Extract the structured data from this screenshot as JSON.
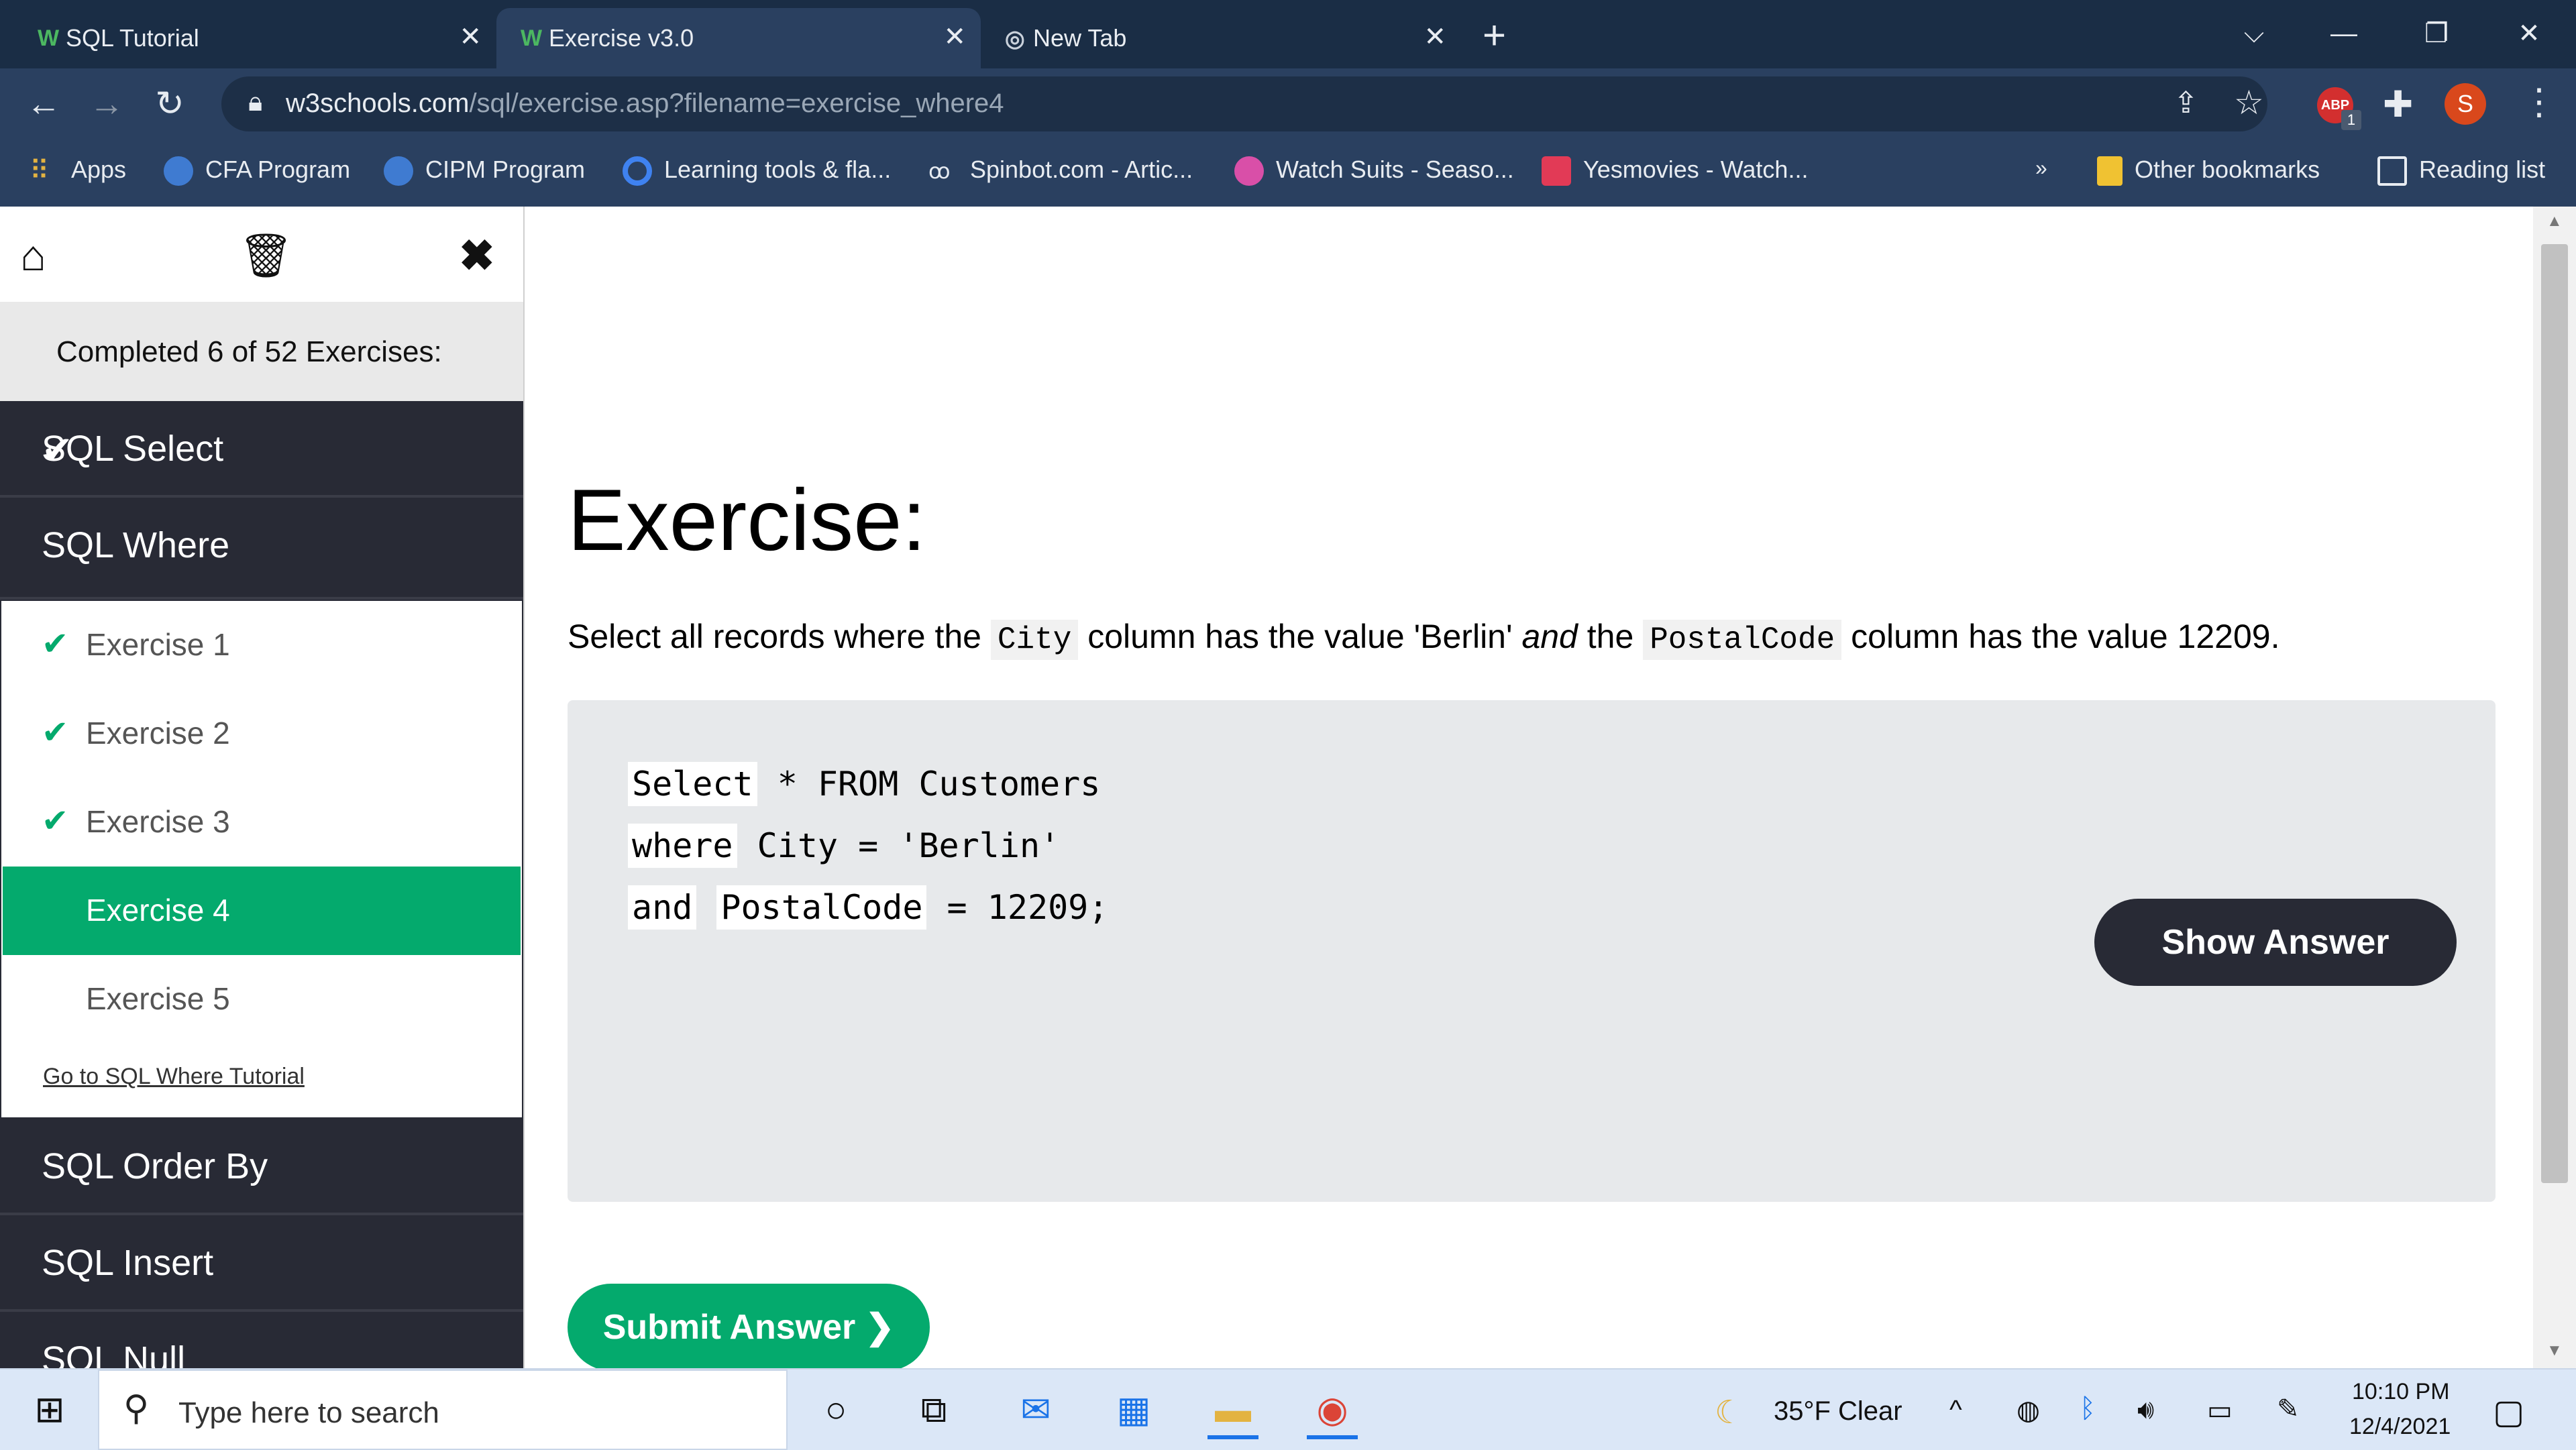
{
  "browser": {
    "tabs": [
      {
        "favicon": "W",
        "title": "SQL Tutorial"
      },
      {
        "favicon": "W",
        "title": "Exercise v3.0"
      },
      {
        "favicon": "chrome-icon",
        "title": "New Tab"
      }
    ],
    "url_host": "w3schools.com",
    "url_path": "/sql/exercise.asp?filename=exercise_where4",
    "profile_initial": "S",
    "bookmarks": [
      {
        "label": "Apps"
      },
      {
        "label": "CFA Program"
      },
      {
        "label": "CIPM Program"
      },
      {
        "label": "Learning tools & fla..."
      },
      {
        "label": "Spinbot.com - Artic..."
      },
      {
        "label": "Watch Suits - Seaso..."
      },
      {
        "label": "Yesmovies - Watch..."
      }
    ],
    "other_bookmarks": "Other bookmarks",
    "reading_list": "Reading list",
    "extension_badge": "1"
  },
  "sidebar": {
    "progress": "Completed 6 of 52 Exercises:",
    "sections_top": [
      {
        "label": "SQL Select",
        "completed": true
      },
      {
        "label": "SQL Where",
        "completed": false
      }
    ],
    "exercises": [
      {
        "label": "Exercise 1",
        "done": true
      },
      {
        "label": "Exercise 2",
        "done": true
      },
      {
        "label": "Exercise 3",
        "done": true
      },
      {
        "label": "Exercise 4",
        "active": true
      },
      {
        "label": "Exercise 5"
      }
    ],
    "tutorial_link": "Go to SQL Where Tutorial",
    "sections_bottom": [
      {
        "label": "SQL Order By"
      },
      {
        "label": "SQL Insert"
      },
      {
        "label": "SQL Null"
      }
    ]
  },
  "main": {
    "title": "Exercise:",
    "desc_1": "Select all records where the",
    "desc_code_1": "City",
    "desc_2": "column has the value 'Berlin'",
    "desc_em": "and",
    "desc_3": "the",
    "desc_code_2": "PostalCode",
    "desc_4": "column has the value 12209.",
    "code": {
      "line1_input": "Select",
      "line1_rest": " * FROM Customers",
      "line2_input": "where",
      "line2_rest": " City = 'Berlin'",
      "line3_input1": "and",
      "line3_input2": "PostalCode",
      "line3_rest": " = 12209;"
    },
    "show_answer": "Show Answer",
    "submit": "Submit Answer ❯"
  },
  "taskbar": {
    "search_placeholder": "Type here to search",
    "weather": "35°F  Clear",
    "time": "10:10 PM",
    "date": "12/4/2021"
  },
  "colors": {
    "accent_green": "#04aa6d",
    "dark": "#282a35",
    "chrome_bg": "#1a2d45"
  }
}
